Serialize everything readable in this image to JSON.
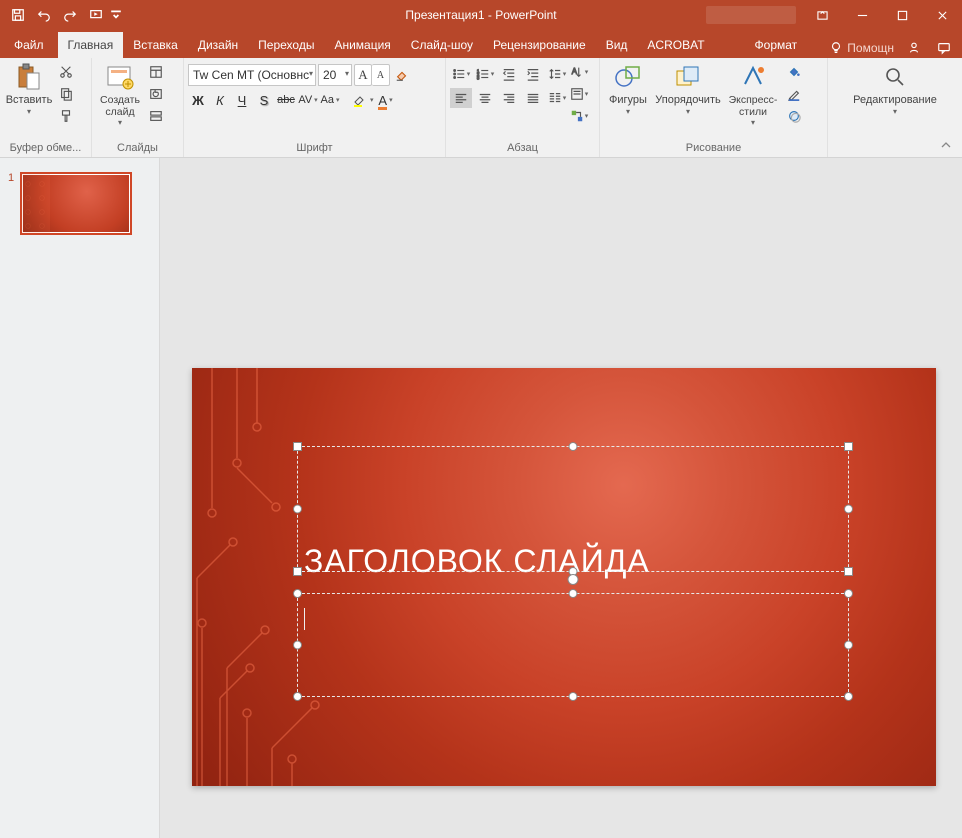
{
  "title": "Презентация1 - PowerPoint",
  "qat": {
    "save": "",
    "undo": "",
    "redo": "",
    "start": ""
  },
  "win": {
    "ribbon_opts": "",
    "min": "",
    "max": "",
    "close": ""
  },
  "tabs": {
    "file": "Файл",
    "items": [
      {
        "label": "Главная",
        "active": true
      },
      {
        "label": "Вставка"
      },
      {
        "label": "Дизайн"
      },
      {
        "label": "Переходы"
      },
      {
        "label": "Анимация"
      },
      {
        "label": "Слайд-шоу"
      },
      {
        "label": "Рецензирование"
      },
      {
        "label": "Вид"
      },
      {
        "label": "ACROBAT"
      }
    ],
    "contextual": "Формат",
    "tell_me": "Помощн",
    "share_icon": "",
    "comment_icon": ""
  },
  "ribbon": {
    "clipboard": {
      "paste": "Вставить",
      "label": "Буфер обме..."
    },
    "slides": {
      "new_slide": "Создать слайд",
      "layout": "",
      "reset": "",
      "section": "",
      "label": "Слайды"
    },
    "font": {
      "name": "Tw Cen MT (Основнс",
      "size": "20",
      "grow": "A",
      "shrink": "A",
      "clear": "",
      "bold": "Ж",
      "italic": "К",
      "underline": "Ч",
      "shadow": "S",
      "strike": "abc",
      "spacing": "AV",
      "case": "Aa",
      "highlight": "",
      "color": "A",
      "label": "Шрифт"
    },
    "paragraph": {
      "label": "Абзац"
    },
    "drawing": {
      "shapes": "Фигуры",
      "arrange": "Упорядочить",
      "styles": "Экспресс-стили",
      "label": "Рисование"
    },
    "editing": {
      "label": "Редактирование"
    }
  },
  "thumbs": {
    "slide1_num": "1"
  },
  "slide": {
    "title": "ЗАГОЛОВОК СЛАЙДА"
  }
}
